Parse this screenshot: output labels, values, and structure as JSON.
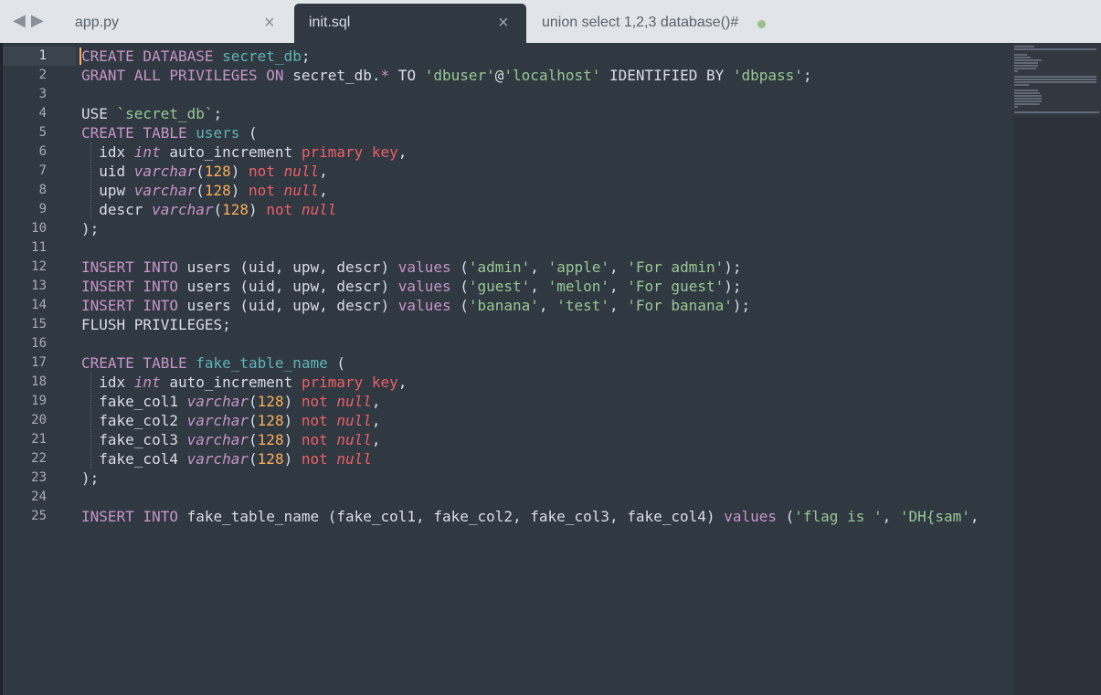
{
  "tabs": {
    "nav_back": "◀",
    "nav_forward": "▶",
    "items": [
      {
        "label": "app.py",
        "close": "×"
      },
      {
        "label": "init.sql",
        "close": "×"
      },
      {
        "label": "union select 1,2,3 database()#"
      }
    ]
  },
  "gutter": {
    "line_numbers": [
      "1",
      "2",
      "3",
      "4",
      "5",
      "6",
      "7",
      "8",
      "9",
      "10",
      "11",
      "12",
      "13",
      "14",
      "15",
      "16",
      "17",
      "18",
      "19",
      "20",
      "21",
      "22",
      "23",
      "24",
      "25"
    ]
  },
  "code": {
    "l1": {
      "a": "CREATE DATABASE",
      "b": "secret_db",
      "c": ";"
    },
    "l2": {
      "a": "GRANT ALL PRIVILEGES",
      "b": "ON",
      "c": " secret_db.",
      "d": "*",
      "e": " TO ",
      "f": "'dbuser'",
      "g": "@",
      "h": "'localhost'",
      "i": " IDENTIFIED BY ",
      "j": "'dbpass'",
      "k": ";"
    },
    "l4": {
      "a": "USE ",
      "b": "`secret_db`",
      "c": ";"
    },
    "l5": {
      "a": "CREATE TABLE",
      "b": "users",
      "c": " ("
    },
    "l6": {
      "a": "idx ",
      "b": "int",
      "c": " auto_increment ",
      "d": "primary key",
      "e": ","
    },
    "l7": {
      "a": "uid ",
      "b": "varchar",
      "c": "(",
      "d": "128",
      "e": ") ",
      "f": "not",
      "g": " ",
      "h": "null",
      "i": ","
    },
    "l8": {
      "a": "upw ",
      "b": "varchar",
      "c": "(",
      "d": "128",
      "e": ") ",
      "f": "not",
      "g": " ",
      "h": "null",
      "i": ","
    },
    "l9": {
      "a": "descr ",
      "b": "varchar",
      "c": "(",
      "d": "128",
      "e": ") ",
      "f": "not",
      "g": " ",
      "h": "null"
    },
    "l10": {
      "a": ");"
    },
    "l12": {
      "a": "INSERT INTO",
      "b": " users (uid, upw, descr) ",
      "c": "values",
      "d": " (",
      "e": "'admin'",
      "f": ", ",
      "g": "'apple'",
      "h": ", ",
      "i": "'For admin'",
      "j": ");"
    },
    "l13": {
      "a": "INSERT INTO",
      "b": " users (uid, upw, descr) ",
      "c": "values",
      "d": " (",
      "e": "'guest'",
      "f": ", ",
      "g": "'melon'",
      "h": ", ",
      "i": "'For guest'",
      "j": ");"
    },
    "l14": {
      "a": "INSERT INTO",
      "b": " users (uid, upw, descr) ",
      "c": "values",
      "d": " (",
      "e": "'banana'",
      "f": ", ",
      "g": "'test'",
      "h": ", ",
      "i": "'For banana'",
      "j": ");"
    },
    "l15": {
      "a": "FLUSH PRIVILEGES;"
    },
    "l17": {
      "a": "CREATE TABLE",
      "b": "fake_table_name",
      "c": " ("
    },
    "l18": {
      "a": "idx ",
      "b": "int",
      "c": " auto_increment ",
      "d": "primary key",
      "e": ","
    },
    "l19": {
      "a": "fake_col1 ",
      "b": "varchar",
      "c": "(",
      "d": "128",
      "e": ") ",
      "f": "not",
      "g": " ",
      "h": "null",
      "i": ","
    },
    "l20": {
      "a": "fake_col2 ",
      "b": "varchar",
      "c": "(",
      "d": "128",
      "e": ") ",
      "f": "not",
      "g": " ",
      "h": "null",
      "i": ","
    },
    "l21": {
      "a": "fake_col3 ",
      "b": "varchar",
      "c": "(",
      "d": "128",
      "e": ") ",
      "f": "not",
      "g": " ",
      "h": "null",
      "i": ","
    },
    "l22": {
      "a": "fake_col4 ",
      "b": "varchar",
      "c": "(",
      "d": "128",
      "e": ") ",
      "f": "not",
      "g": " ",
      "h": "null"
    },
    "l23": {
      "a": ");"
    },
    "l25": {
      "a": "INSERT INTO",
      "b": " fake_table_name (fake_col1, fake_col2, fake_col3, fake_col4) ",
      "c": "values",
      "d": " (",
      "e": "'flag is '",
      "f": ", ",
      "g": "'DH{sam'",
      "h": ","
    }
  },
  "colors": {
    "background": "#303841",
    "keyword": "#c695c6",
    "name": "#5fb4b4",
    "string": "#99c794",
    "number": "#f9ae58",
    "red_keyword": "#ec5f66",
    "cursor": "#f9ae58",
    "modified_dot": "#9dc08b"
  }
}
